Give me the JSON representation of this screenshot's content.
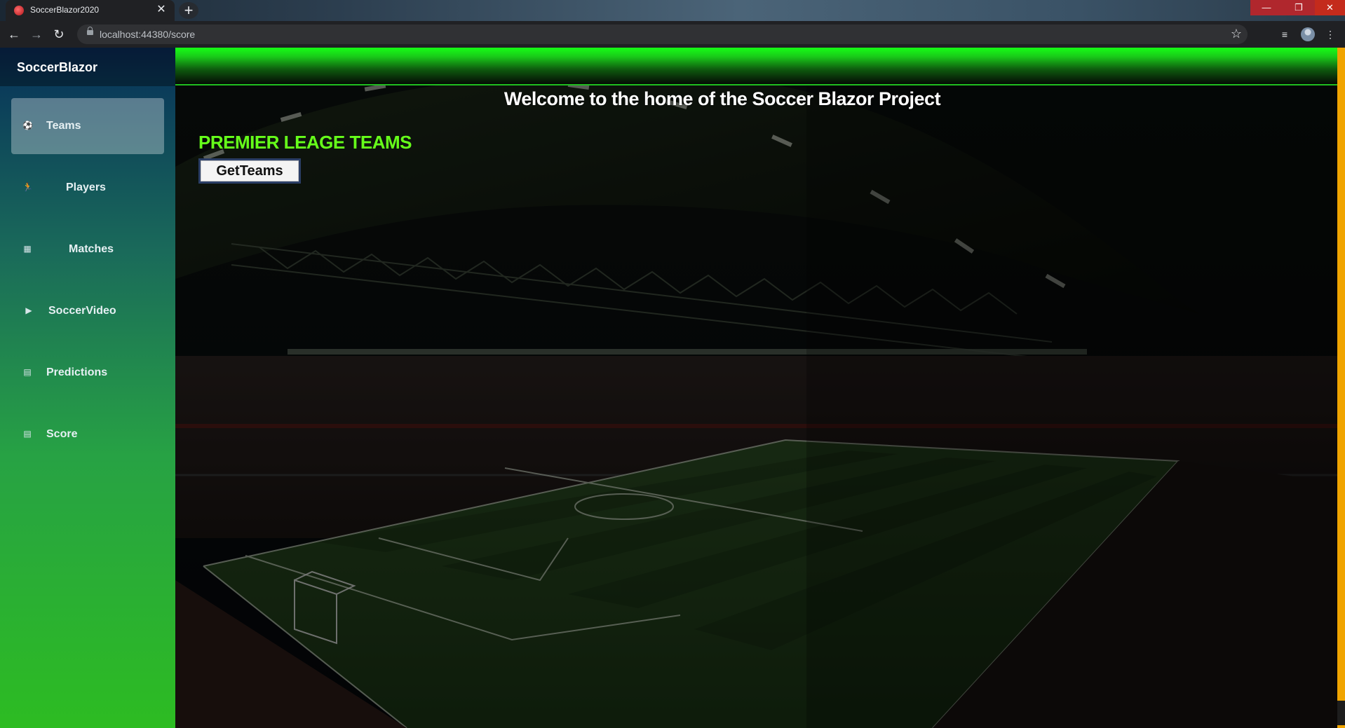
{
  "browser": {
    "tab_title": "SoccerBlazor2020",
    "url": "localhost:44380/score",
    "tab_close_glyph": "✕",
    "new_tab_glyph": "+",
    "minimize_glyph": "—",
    "maximize_glyph": "❐",
    "close_glyph": "✕",
    "back_glyph": "←",
    "forward_glyph": "→",
    "reload_glyph": "↻",
    "star_glyph": "☆",
    "media_glyph": "≡",
    "menu_glyph": "⋮"
  },
  "app": {
    "brand": "SoccerBlazor",
    "nav": [
      {
        "label": "Teams",
        "icon": "soccer-ball-icon",
        "glyph": "⚽",
        "active": true
      },
      {
        "label": "Players",
        "icon": "running-player-icon",
        "glyph": "🏃",
        "active": false
      },
      {
        "label": "Matches",
        "icon": "stadium-icon",
        "glyph": "▦",
        "active": false
      },
      {
        "label": "SoccerVideo",
        "icon": "video-camera-icon",
        "glyph": "▶",
        "active": false
      },
      {
        "label": "Predictions",
        "icon": "document-icon",
        "glyph": "▤",
        "active": false
      },
      {
        "label": "Score",
        "icon": "document-icon",
        "glyph": "▤",
        "active": false
      }
    ]
  },
  "main": {
    "welcome": "Welcome to the home of the Soccer Blazor Project",
    "section_title": "PREMIER LEAGE TEAMS",
    "get_teams_label": "GetTeams"
  },
  "colors": {
    "accent_green": "#66ff1a",
    "sidebar_top": "#0a2a55",
    "sidebar_bottom": "#2dbc22",
    "scrollbar": "#f0a400"
  }
}
